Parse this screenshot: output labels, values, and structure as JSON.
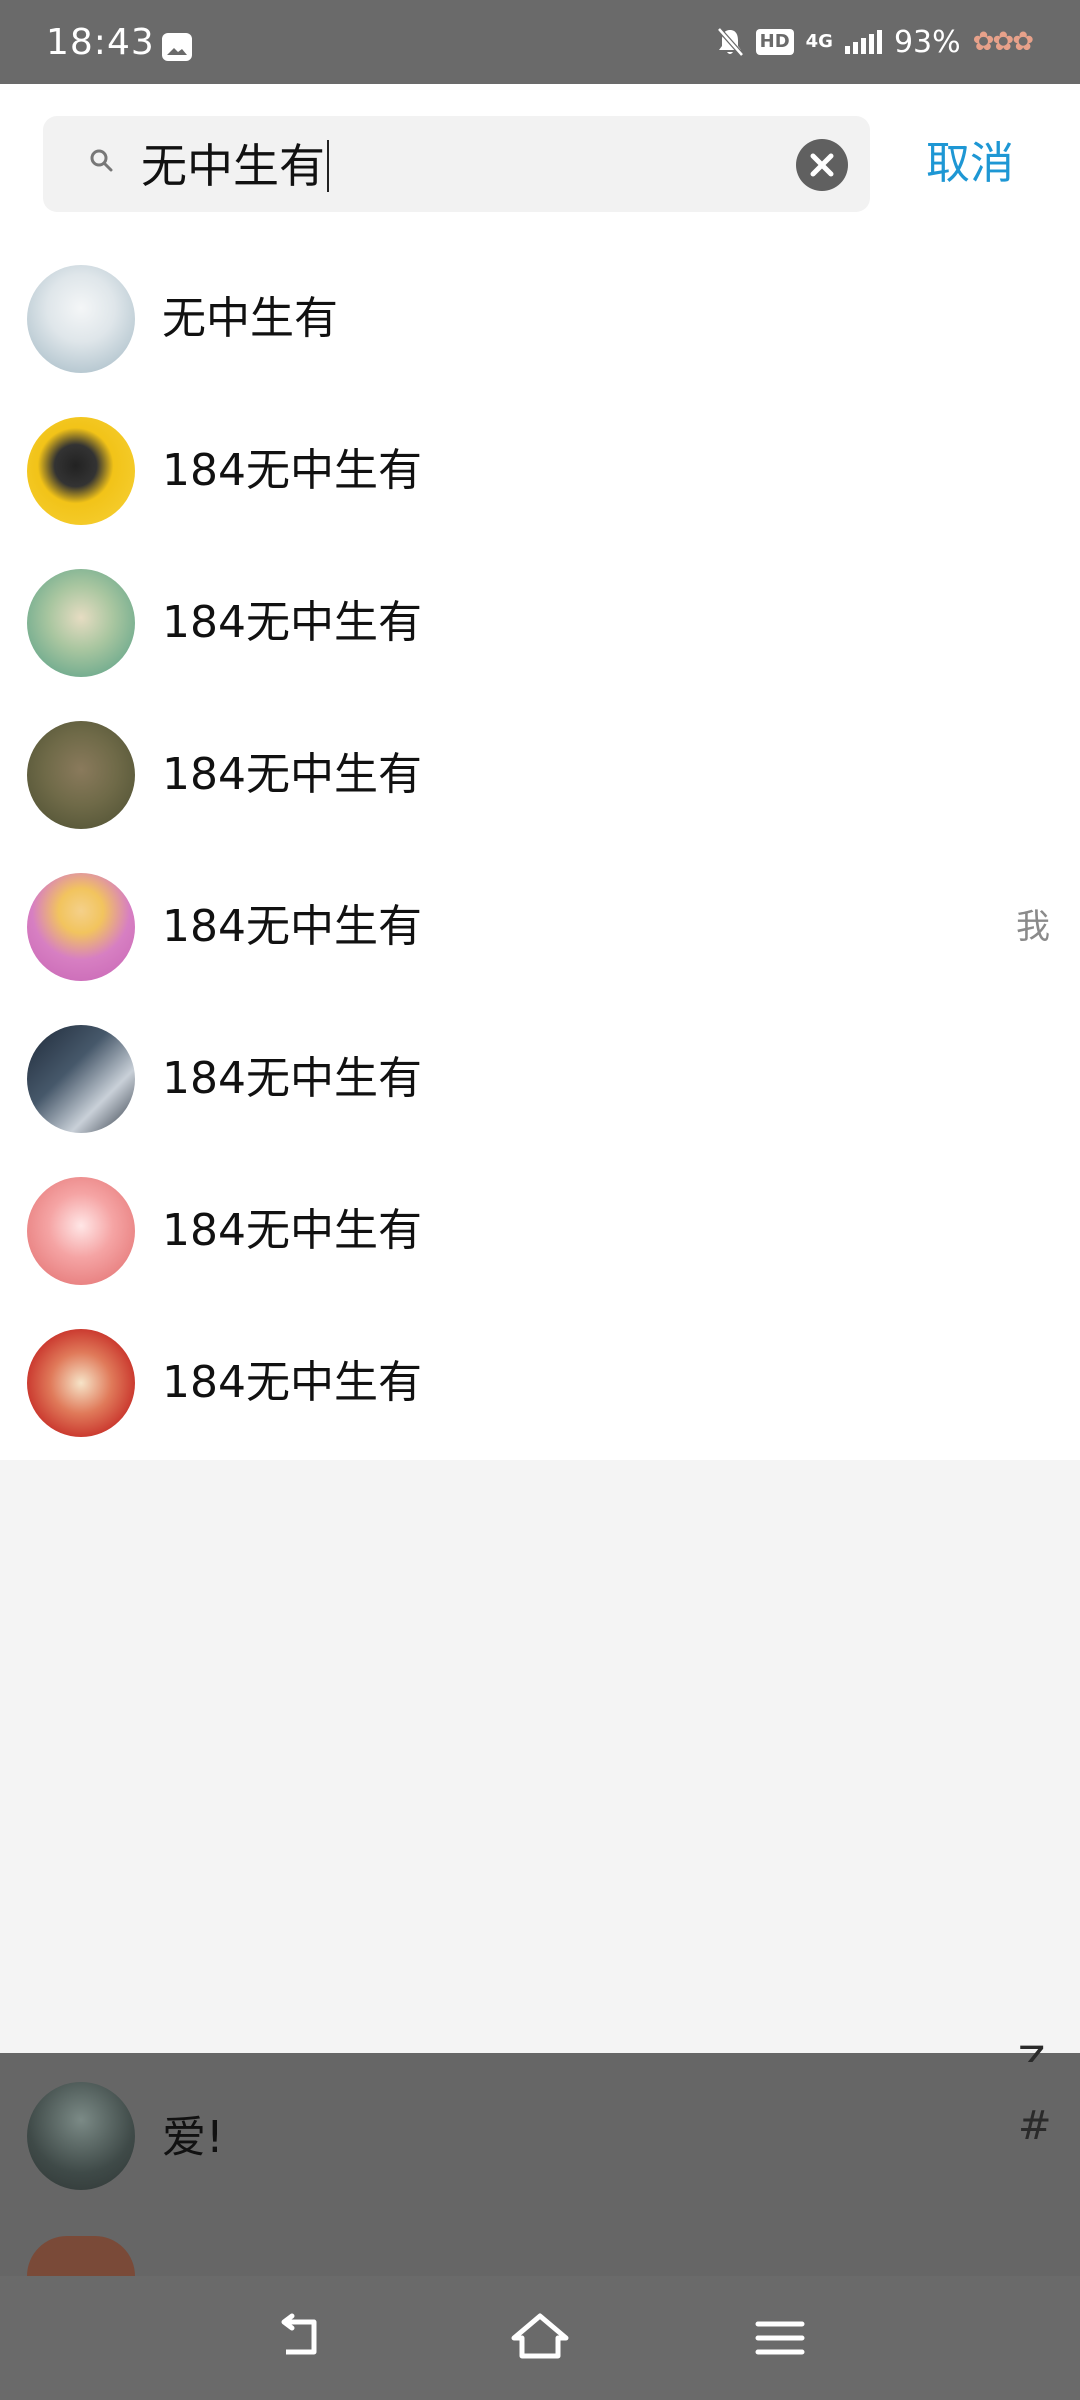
{
  "status_bar": {
    "time": "18:43",
    "hd_label": "HD",
    "network_label": "4G",
    "battery": "93%",
    "icons": [
      "gallery-icon",
      "mute-bell-icon",
      "hd-icon",
      "signal-icon",
      "decorative-flower-icon"
    ]
  },
  "search": {
    "query": "无中生有",
    "cancel_label": "取消",
    "accent_color": "#1e97d4"
  },
  "results": [
    {
      "name": "无中生有",
      "tag": ""
    },
    {
      "name": "184无中生有",
      "tag": ""
    },
    {
      "name": "184无中生有",
      "tag": ""
    },
    {
      "name": "184无中生有",
      "tag": ""
    },
    {
      "name": "184无中生有",
      "tag": "我"
    },
    {
      "name": "184无中生有",
      "tag": ""
    },
    {
      "name": "184无中生有",
      "tag": ""
    },
    {
      "name": "184无中生有",
      "tag": ""
    }
  ],
  "background_list": {
    "visible_contact": "爱!",
    "index_letters": [
      "Z",
      "#"
    ]
  },
  "nav_bar": {
    "buttons": [
      "back-icon",
      "home-icon",
      "menu-icon"
    ]
  }
}
